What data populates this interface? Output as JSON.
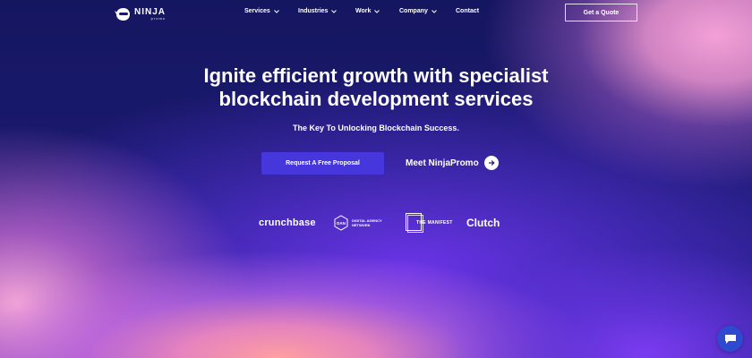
{
  "header": {
    "logo": {
      "wordmark": "NINJA",
      "sub": "promo"
    },
    "nav": [
      {
        "label": "Services",
        "has_dropdown": true
      },
      {
        "label": "Industries",
        "has_dropdown": true
      },
      {
        "label": "Work",
        "has_dropdown": true
      },
      {
        "label": "Company",
        "has_dropdown": true
      },
      {
        "label": "Contact",
        "has_dropdown": false
      }
    ],
    "quote_button": "Get a Quote"
  },
  "hero": {
    "title_line1": "Ignite efficient growth with specialist",
    "title_line2": "blockchain development services",
    "subtitle": "The Key To Unlocking Blockchain Success.",
    "primary_cta": "Request A Free Proposal",
    "secondary_cta": "Meet NinjaPromo"
  },
  "partners": {
    "crunchbase": "crunchbase",
    "dan_mark": "DAN",
    "dan_line1": "DIGITAL AGENCY",
    "dan_line2": "NETWORK",
    "manifest": "THE MANIFEST",
    "clutch": "Clutch"
  },
  "icons": {
    "chat": "chat-bubble-icon",
    "arrow": "arrow-right-icon",
    "chevron": "chevron-down-icon"
  },
  "colors": {
    "background_deep": "#191a6e",
    "primary_button": "#4537dc",
    "chat_button": "#2f49d1",
    "accent_pink": "#f4a0d6"
  }
}
